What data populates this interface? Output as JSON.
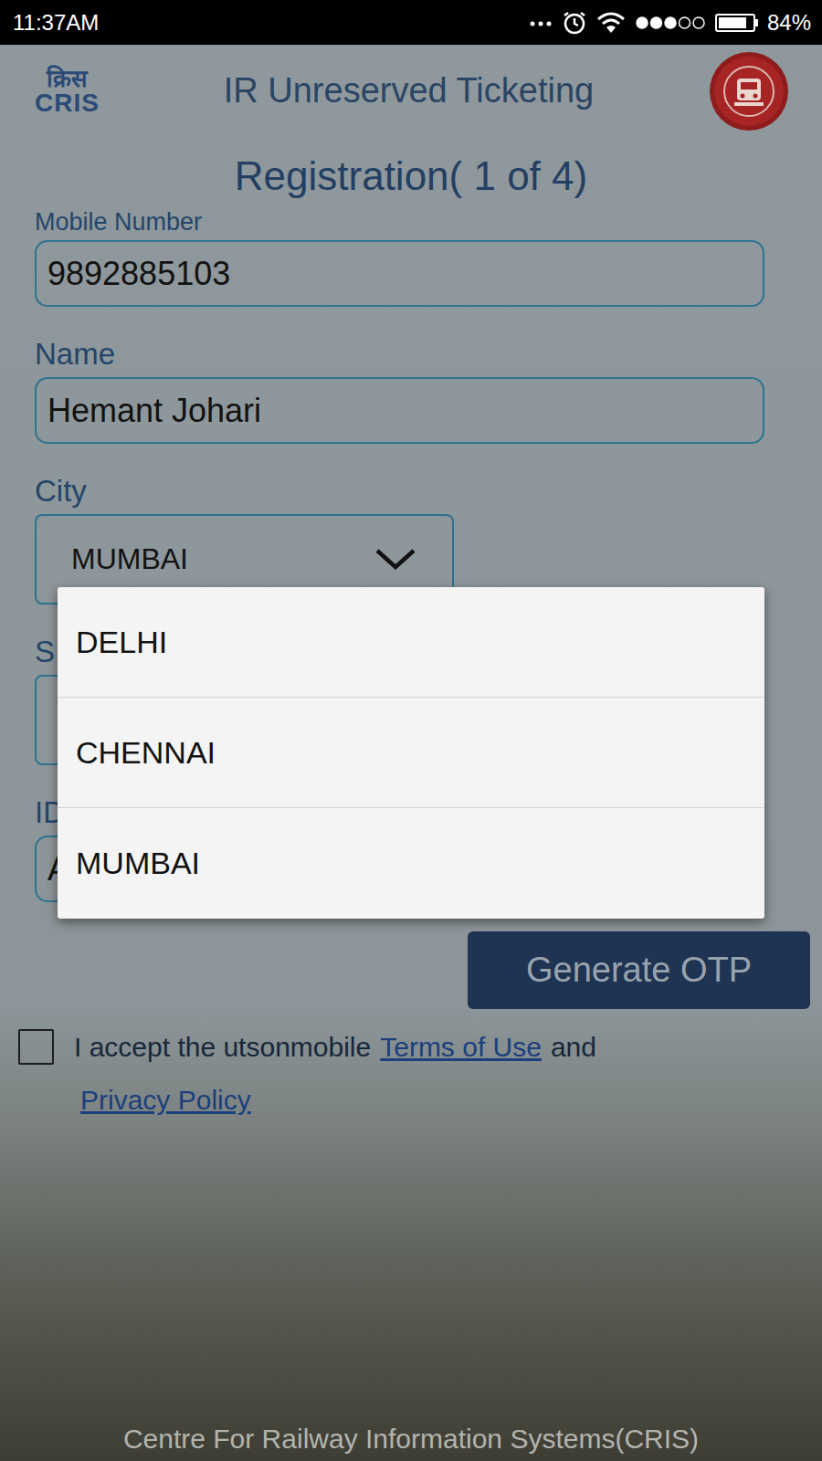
{
  "status_bar": {
    "time": "11:37AM",
    "signal_level": 0.6,
    "battery_level": 0.84,
    "battery": "84%"
  },
  "header": {
    "logo_hindi": "क्रिस",
    "logo": "CRIS",
    "title": "IR Unreserved Ticketing"
  },
  "page_title": "Registration( 1 of 4)",
  "fields": [
    {
      "label": "Mobile Number",
      "value": "9892885103",
      "kind": "text"
    },
    {
      "label": "Name",
      "value": "Hemant Johari",
      "kind": "text"
    },
    {
      "label": "City",
      "value": "MUMBAI",
      "kind": "select"
    },
    {
      "label": "S",
      "value": "",
      "kind": "select"
    },
    {
      "label": "ID",
      "value": "A",
      "kind": "text"
    }
  ],
  "dropdown": {
    "options": [
      "DELHI",
      "CHENNAI",
      "MUMBAI"
    ]
  },
  "button": "Generate OTP",
  "terms": {
    "checked": false,
    "text": "I accept the utsonmobile",
    "link1": "Terms of Use",
    "joiner": "and",
    "link2": "Privacy Policy"
  },
  "footer": "Centre For Railway Information Systems(CRIS)"
}
